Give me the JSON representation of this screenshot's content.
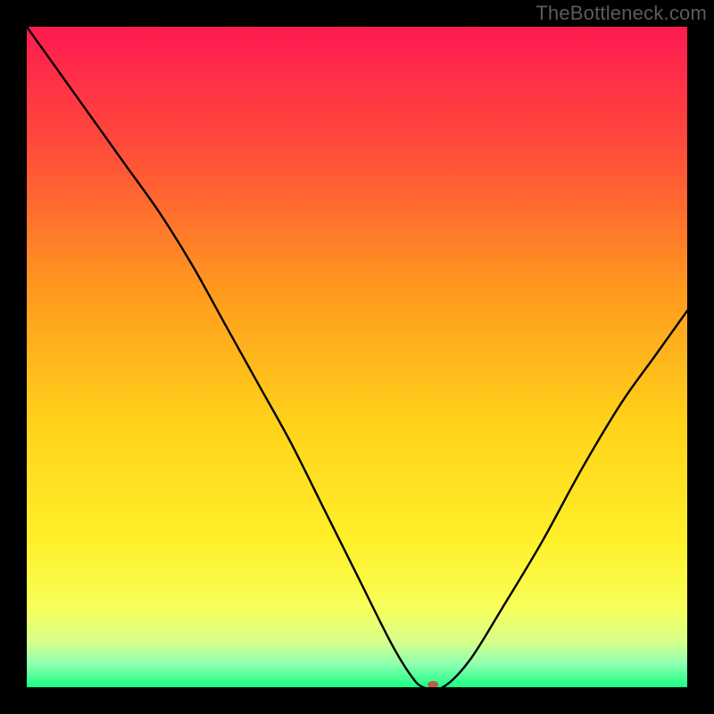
{
  "watermark": "TheBottleneck.com",
  "chart_data": {
    "type": "line",
    "title": "",
    "xlabel": "",
    "ylabel": "",
    "xlim": [
      0,
      100
    ],
    "ylim": [
      0,
      100
    ],
    "grid": false,
    "legend": false,
    "background_gradient": {
      "stops": [
        {
          "offset": 0.0,
          "color": "#ff1a52"
        },
        {
          "offset": 0.18,
          "color": "#ff4b3a"
        },
        {
          "offset": 0.4,
          "color": "#ff9a1f"
        },
        {
          "offset": 0.6,
          "color": "#ffd21a"
        },
        {
          "offset": 0.78,
          "color": "#fff02a"
        },
        {
          "offset": 0.88,
          "color": "#f7ff5a"
        },
        {
          "offset": 0.93,
          "color": "#d9ff8a"
        },
        {
          "offset": 0.965,
          "color": "#8effb0"
        },
        {
          "offset": 1.0,
          "color": "#17ff83"
        }
      ]
    },
    "series": [
      {
        "name": "bottleneck-curve",
        "x": [
          0,
          5,
          10,
          15,
          20,
          25,
          30,
          35,
          40,
          45,
          50,
          55,
          58,
          60,
          63,
          67,
          72,
          78,
          84,
          90,
          95,
          100
        ],
        "y": [
          100,
          93,
          86,
          79,
          72,
          64,
          55,
          46,
          37,
          27,
          17,
          7,
          2,
          0,
          0,
          4,
          12,
          22,
          33,
          43,
          50,
          57
        ],
        "color": "#000000",
        "width": 2.4
      }
    ],
    "marker": {
      "name": "optimal-point",
      "x": 61.5,
      "y": 0,
      "rx": 6,
      "ry": 4,
      "color": "#c1584d"
    }
  }
}
